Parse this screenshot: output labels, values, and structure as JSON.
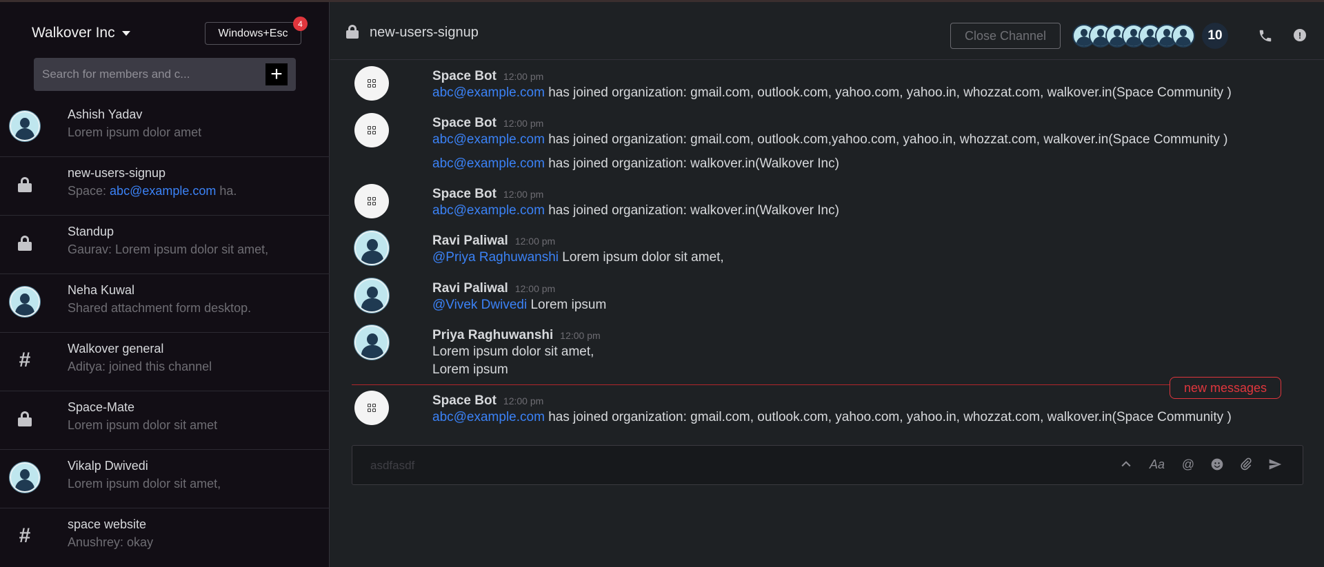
{
  "workspace": {
    "name": "Walkover Inc",
    "shortcut_label": "Windows+Esc",
    "shortcut_badge": "4"
  },
  "search": {
    "placeholder": "Search for members and c...",
    "add_label": "+"
  },
  "channels": [
    {
      "title": "Ashish Yadav",
      "sub_prefix": "",
      "sub_link": "",
      "sub_text": "Lorem ipsum dolor amet",
      "icon": "user-avatar"
    },
    {
      "title": "new-users-signup",
      "sub_prefix": "Space: ",
      "sub_link": "abc@example.com",
      "sub_text": " ha.",
      "icon": "lock-icon"
    },
    {
      "title": "Standup",
      "sub_prefix": "",
      "sub_link": "",
      "sub_text": "Gaurav: Lorem ipsum dolor sit amet,",
      "icon": "lock-icon"
    },
    {
      "title": "Neha Kuwal",
      "sub_prefix": "",
      "sub_link": "",
      "sub_text": "Shared attachment form desktop.",
      "icon": "user-avatar"
    },
    {
      "title": "Walkover general",
      "sub_prefix": "",
      "sub_link": "",
      "sub_text": "Aditya: joined this channel",
      "icon": "hash-icon"
    },
    {
      "title": "Space-Mate",
      "sub_prefix": "",
      "sub_link": "",
      "sub_text": "Lorem ipsum dolor sit amet",
      "icon": "lock-icon"
    },
    {
      "title": "Vikalp Dwivedi",
      "sub_prefix": "",
      "sub_link": "",
      "sub_text": " Lorem ipsum dolor sit amet,",
      "icon": "user-avatar"
    },
    {
      "title": "space website",
      "sub_prefix": "",
      "sub_link": "",
      "sub_text": "Anushrey: okay",
      "icon": "hash-icon"
    }
  ],
  "header": {
    "channel_name": "new-users-signup",
    "close_label": "Close Channel",
    "member_count": "10"
  },
  "messages": [
    {
      "sender": "Space Bot",
      "time": "12:00 pm",
      "link": "abc@example.com",
      "text": " has joined organization: gmail.com, outlook.com, yahoo.com, yahoo.in, whozzat.com, walkover.in(Space Community )"
    },
    {
      "sender": "Space Bot",
      "time": "12:00 pm",
      "link": "abc@example.com",
      "text": " has joined organization: gmail.com, outlook.com,yahoo.com, yahoo.in, whozzat.com, walkover.in(Space Community )",
      "extra_link": "abc@example.com",
      "extra_text": " has joined organization: walkover.in(Walkover Inc)"
    },
    {
      "sender": "Space Bot",
      "time": "12:00 pm",
      "link": "abc@example.com",
      "text": " has joined organization: walkover.in(Walkover Inc)"
    },
    {
      "sender": "Ravi Paliwal",
      "time": "12:00 pm",
      "link": "@Priya Raghuwanshi",
      "text": " Lorem ipsum dolor sit amet,"
    },
    {
      "sender": "Ravi Paliwal",
      "time": "12:00 pm",
      "link": "@Vivek Dwivedi",
      "text": " Lorem ipsum"
    },
    {
      "sender": "Priya Raghuwanshi",
      "time": "12:00 pm",
      "line1": "Lorem ipsum dolor sit amet,",
      "line2": "Lorem ipsum"
    },
    {
      "sender": "Space Bot",
      "time": "12:00 pm",
      "link": "abc@example.com",
      "text": " has joined organization: gmail.com, outlook.com, yahoo.com, yahoo.in, whozzat.com, walkover.in(Space Community )"
    }
  ],
  "new_messages_label": "new messages",
  "composer": {
    "value": "asdfasdf",
    "format_label": "Aa",
    "mention_label": "@"
  }
}
